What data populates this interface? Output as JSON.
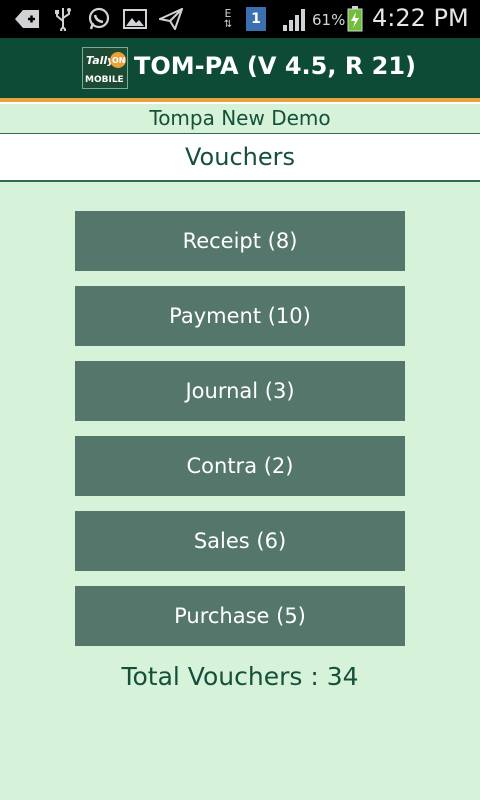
{
  "status_bar": {
    "icons": [
      "add-box-icon",
      "usb-icon",
      "whatsapp-icon",
      "gallery-icon",
      "send-icon",
      "data-e-icon",
      "sim-1-icon",
      "signal-icon",
      "battery-charging-icon"
    ],
    "data_type": "E",
    "sim_label": "1",
    "battery_percent": "61%",
    "time": "4:22 PM"
  },
  "app": {
    "logo_text": {
      "top": "Tally",
      "badge": "ON",
      "bottom": "MOBILE"
    },
    "title": "TOM-PA (V 4.5, R 21)"
  },
  "company": "Tompa New Demo",
  "section_title": "Vouchers",
  "vouchers": [
    {
      "label": "Receipt (8)"
    },
    {
      "label": "Payment (10)"
    },
    {
      "label": "Journal (3)"
    },
    {
      "label": "Contra (2)"
    },
    {
      "label": "Sales (6)"
    },
    {
      "label": "Purchase (5)"
    }
  ],
  "total": "Total Vouchers : 34",
  "colors": {
    "header": "#0e4b37",
    "background": "#d6f2d9",
    "button": "#55776b",
    "accent_line": "#e8a23b",
    "text_dark": "#15503b"
  }
}
